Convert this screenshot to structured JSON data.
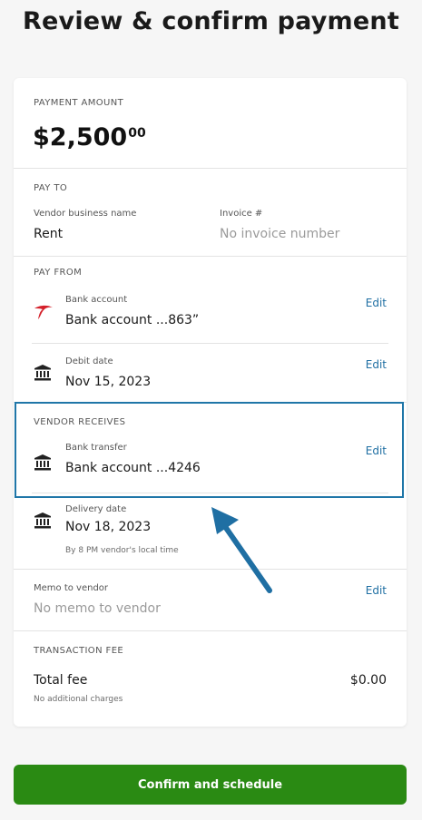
{
  "page": {
    "title": "Review & confirm payment"
  },
  "amount": {
    "label": "PAYMENT AMOUNT",
    "dollars": "$2,500",
    "cents": "00"
  },
  "pay_to": {
    "label": "PAY TO",
    "vendor_label": "Vendor business name",
    "vendor_value": "Rent",
    "invoice_label": "Invoice #",
    "invoice_placeholder": "No invoice number"
  },
  "pay_from": {
    "label": "PAY FROM",
    "bank_label": "Bank account",
    "bank_value": "Bank account ...863”",
    "debit_label": "Debit date",
    "debit_value": "Nov 15, 2023",
    "edit": "Edit"
  },
  "vendor_receives": {
    "label": "VENDOR RECEIVES",
    "transfer_label": "Bank transfer",
    "transfer_value": "Bank account ...4246",
    "delivery_label": "Delivery date",
    "delivery_value": "Nov 18, 2023",
    "delivery_hint": "By 8 PM vendor's local time",
    "edit": "Edit"
  },
  "memo": {
    "label": "Memo to vendor",
    "placeholder": "No memo to vendor",
    "edit": "Edit"
  },
  "fee": {
    "label": "TRANSACTION FEE",
    "total_label": "Total fee",
    "total_value": "$0.00",
    "hint": "No additional charges"
  },
  "actions": {
    "confirm_label": "Confirm and schedule"
  },
  "colors": {
    "accent": "#1f6fa3",
    "confirm": "#2a8a13",
    "highlight": "#1f76a8",
    "bank_logo": "#d4202a"
  },
  "icons": [
    "bank-logo-icon",
    "bank-building-icon",
    "arrow-annotation-icon"
  ]
}
